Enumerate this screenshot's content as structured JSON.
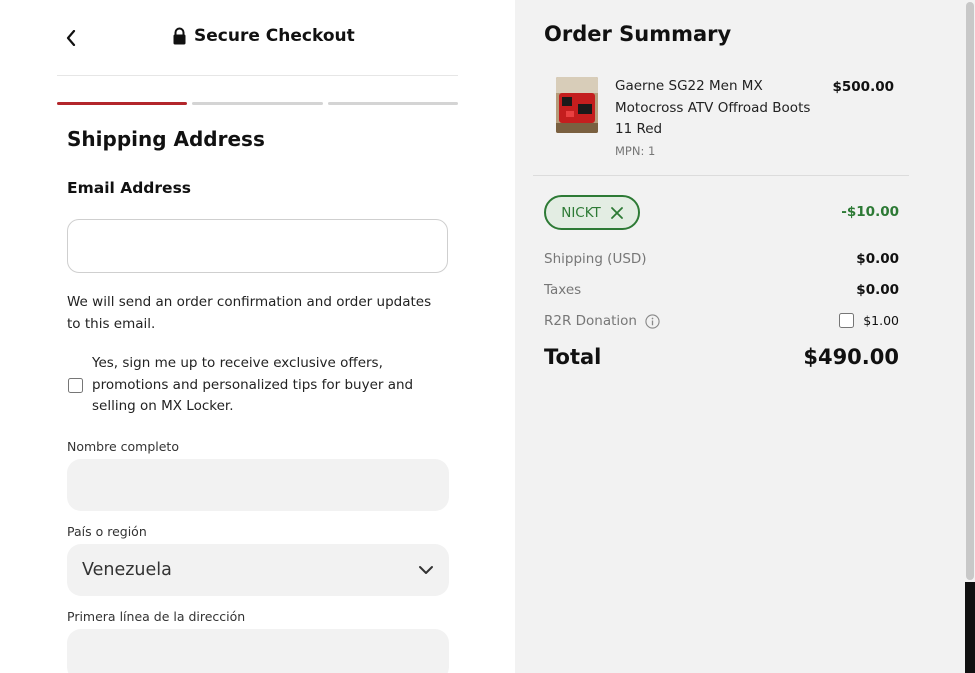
{
  "header": {
    "title": "Secure Checkout"
  },
  "shipping": {
    "section_title": "Shipping Address",
    "email_label": "Email Address",
    "email_value": "",
    "email_helper": "We will send an order confirmation and order updates to this email.",
    "opt_in_text": "Yes, sign me up to receive exclusive offers, promotions and personalized tips for buyer and selling on MX Locker.",
    "opt_in_checked": false,
    "full_name_label": "Nombre completo",
    "full_name_value": "",
    "country_label": "País o región",
    "country_value": "Venezuela",
    "address1_label": "Primera línea de la dirección",
    "address1_value": ""
  },
  "steps": {
    "count": 3,
    "active_index": 0
  },
  "summary": {
    "title": "Order Summary",
    "product": {
      "name": "Gaerne SG22 Men MX Motocross ATV Offroad Boots 11 Red",
      "price": "$500.00",
      "mpn": "MPN: 1"
    },
    "coupon_code": "NICKT",
    "discount": "-$10.00",
    "shipping_label": "Shipping (USD)",
    "shipping_value": "$0.00",
    "taxes_label": "Taxes",
    "taxes_value": "$0.00",
    "donation_label": "R2R Donation",
    "donation_value": "$1.00",
    "donation_checked": false,
    "total_label": "Total",
    "total_value": "$490.00"
  },
  "colors": {
    "accent_red": "#b3262b",
    "coupon_green": "#2d7a35",
    "panel_gray": "#f2f2f2"
  }
}
